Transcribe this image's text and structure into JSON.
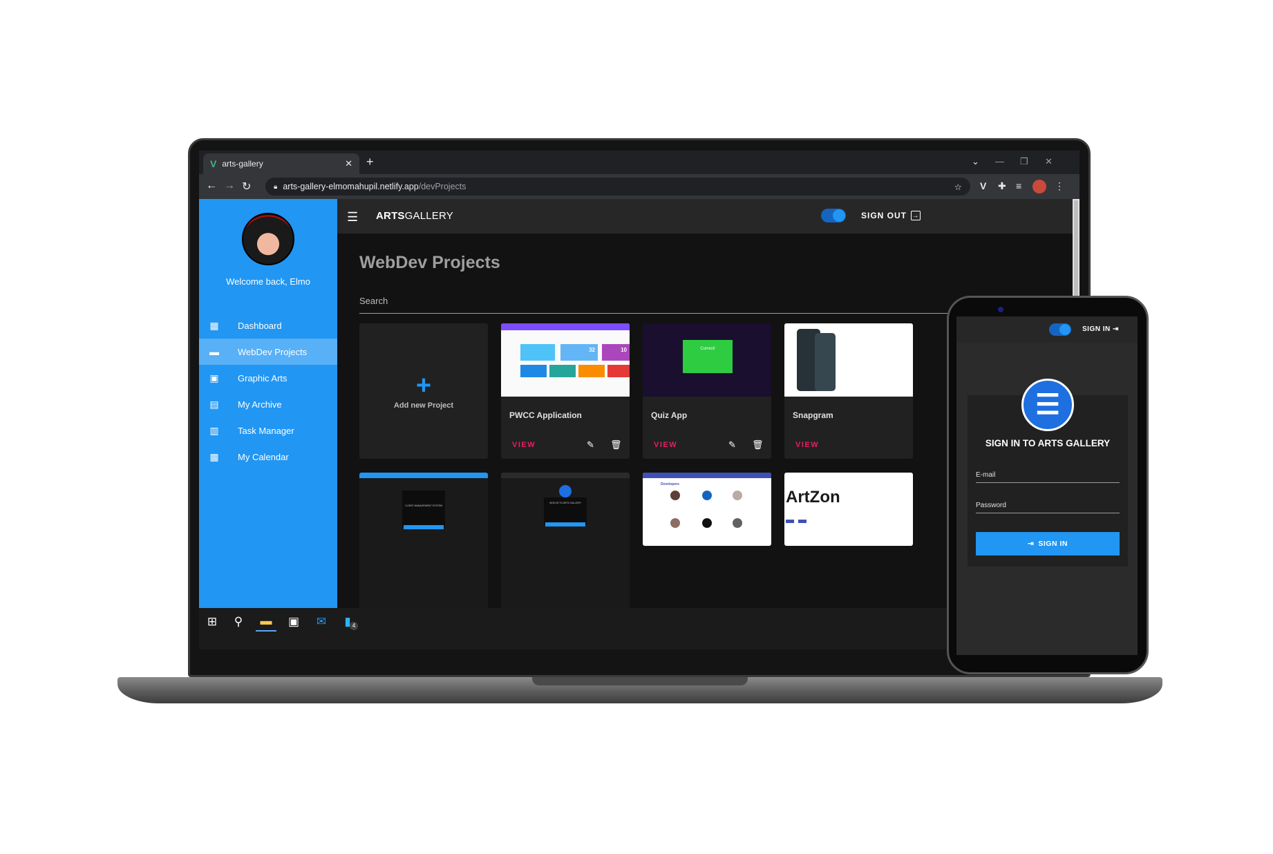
{
  "browser": {
    "tab_title": "arts-gallery",
    "tab_icon": "vue-logo-icon",
    "new_tab": "+",
    "url_host": "arts-gallery-elmomahupil.netlify.app",
    "url_path": "/devProjects"
  },
  "sidebar": {
    "welcome": "Welcome back, Elmo",
    "items": [
      {
        "label": "Dashboard",
        "icon": "dashboard-icon",
        "active": false
      },
      {
        "label": "WebDev Projects",
        "icon": "folder-icon",
        "active": true
      },
      {
        "label": "Graphic Arts",
        "icon": "image-icon",
        "active": false
      },
      {
        "label": "My Archive",
        "icon": "archive-icon",
        "active": false
      },
      {
        "label": "Task Manager",
        "icon": "clipboard-clock-icon",
        "active": false
      },
      {
        "label": "My Calendar",
        "icon": "calendar-icon",
        "active": false
      }
    ]
  },
  "appbar": {
    "brand_bold": "ARTS",
    "brand_rest": "GALLERY",
    "sign_out": "SIGN OUT"
  },
  "main": {
    "title": "WebDev Projects",
    "search_label": "Search",
    "add_project": "Add new Project",
    "cards": [
      {
        "title": "PWCC Application",
        "view": "VIEW"
      },
      {
        "title": "Quiz App",
        "view": "VIEW"
      },
      {
        "title": "Snapgram",
        "view": "VIEW"
      }
    ],
    "thumb_text": {
      "dash_num1": "32",
      "dash_num2": "10",
      "correct": "Correct!",
      "cms": "CLIENT MANAGEMENT SYSTEM",
      "signin_gallery": "SIGN IN TO ARTS GALLERY",
      "developers": "Developers",
      "artzone": "ArtZon"
    }
  },
  "taskbar": {
    "badge": "4"
  },
  "phone": {
    "signin_top": "SIGN IN",
    "title": "SIGN IN TO ARTS GALLERY",
    "email_label": "E-mail",
    "password_label": "Password",
    "button": "SIGN IN"
  },
  "colors": {
    "primary": "#2196f3",
    "view_link": "#e91e63",
    "background": "#121212"
  }
}
